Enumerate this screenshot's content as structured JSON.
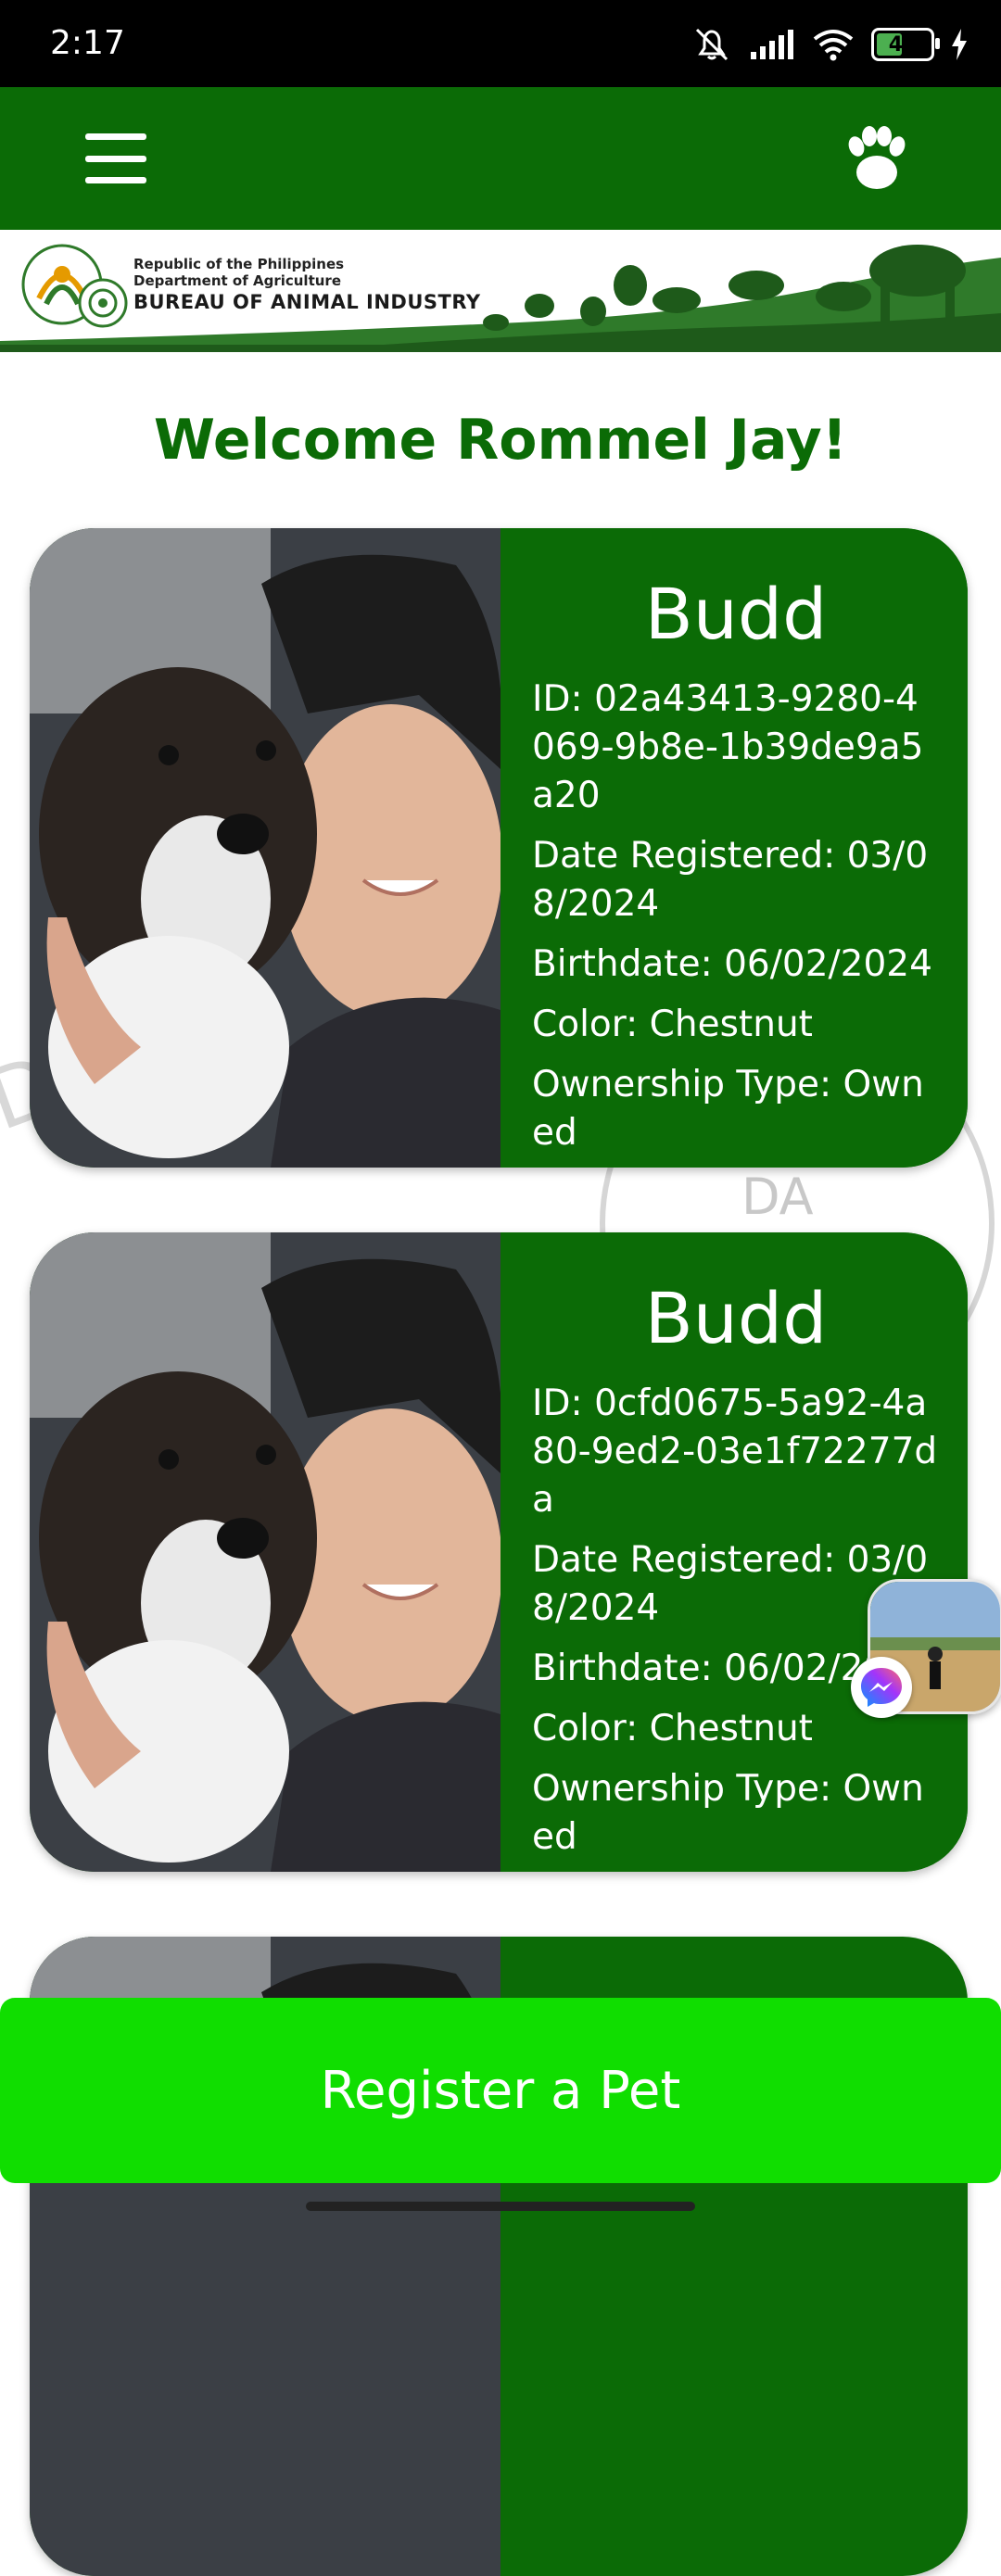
{
  "status_bar": {
    "time": "2:17",
    "battery": "44",
    "icons": [
      "mute-icon",
      "signal-icon",
      "wifi-icon",
      "battery-icon",
      "charging-icon"
    ]
  },
  "app_bar": {
    "menu_icon": "hamburger-menu-icon",
    "paw_icon": "paw-icon",
    "color": "#0b6b06"
  },
  "banner": {
    "line1": "Republic of the Philippines",
    "line2": "Department of Agriculture",
    "line3": "BUREAU OF ANIMAL INDUSTRY"
  },
  "welcome": "Welcome Rommel Jay!",
  "pets": [
    {
      "name": "Budd",
      "id_label": "ID: 02a43413-9280-4069-9b8e-1b39de9a5a20",
      "registered_label": "Date Registered: 03/08/2024",
      "birthdate_label": "Birthdate: 06/02/2024",
      "color_label": "Color: Chestnut",
      "ownership_label": "Ownership Type: Owned"
    },
    {
      "name": "Budd",
      "id_label": "ID: 0cfd0675-5a92-4a80-9ed2-03e1f72277da",
      "registered_label": "Date Registered: 03/08/2024",
      "birthdate_label": "Birthdate: 06/02/20",
      "color_label": "Color: Chestnut",
      "ownership_label": "Ownership Type: Owned"
    }
  ],
  "watermark_text": "DA",
  "register_button": "Register a Pet",
  "colors": {
    "primary_green": "#0b6b06",
    "button_green": "#10de00"
  }
}
